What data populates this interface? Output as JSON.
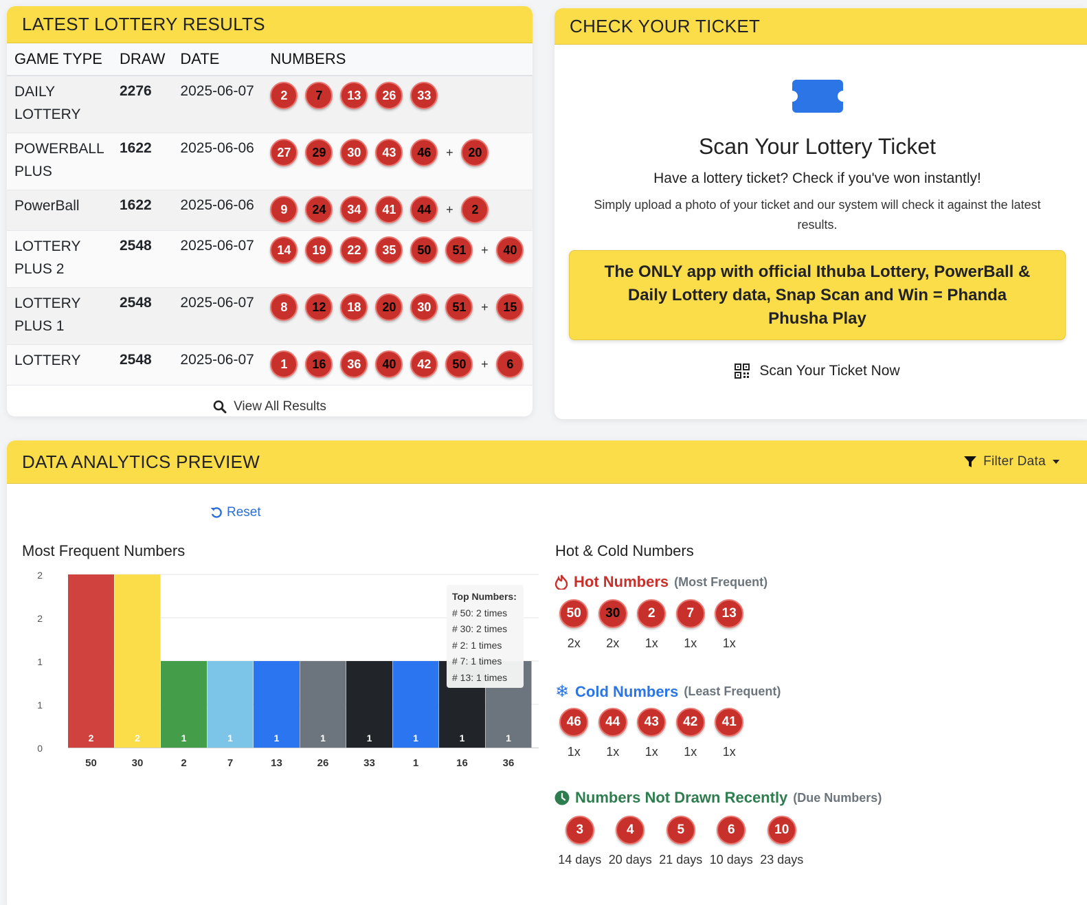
{
  "results": {
    "title": "LATEST LOTTERY RESULTS",
    "headers": [
      "GAME TYPE",
      "DRAW",
      "DATE",
      "NUMBERS"
    ],
    "rows": [
      {
        "game": "DAILY LOTTERY",
        "draw": "2276",
        "date": "2025-06-07",
        "numbers": [
          "2",
          "7",
          "13",
          "26",
          "33"
        ],
        "bonus": ""
      },
      {
        "game": "POWERBALL PLUS",
        "draw": "1622",
        "date": "2025-06-06",
        "numbers": [
          "27",
          "29",
          "30",
          "43",
          "46"
        ],
        "bonus": "20"
      },
      {
        "game": "PowerBall",
        "draw": "1622",
        "date": "2025-06-06",
        "numbers": [
          "9",
          "24",
          "34",
          "41",
          "44"
        ],
        "bonus": "2"
      },
      {
        "game": "LOTTERY PLUS 2",
        "draw": "2548",
        "date": "2025-06-07",
        "numbers": [
          "14",
          "19",
          "22",
          "35",
          "50",
          "51"
        ],
        "bonus": "40"
      },
      {
        "game": "LOTTERY PLUS 1",
        "draw": "2548",
        "date": "2025-06-07",
        "numbers": [
          "8",
          "12",
          "18",
          "20",
          "30",
          "51"
        ],
        "bonus": "15"
      },
      {
        "game": "LOTTERY",
        "draw": "2548",
        "date": "2025-06-07",
        "numbers": [
          "1",
          "16",
          "36",
          "40",
          "42",
          "50"
        ],
        "bonus": "6"
      }
    ],
    "plus_sign": "+",
    "view_all_label": "View All Results"
  },
  "ticket": {
    "title": "CHECK YOUR TICKET",
    "scan_title": "Scan Your Lottery Ticket",
    "scan_sub": "Have a lottery ticket? Check if you've won instantly!",
    "scan_desc": "Simply upload a photo of your ticket and our system will check it against the latest results.",
    "promo": "The ONLY app with official Ithuba Lottery, PowerBall & Daily Lottery data, Snap Scan and Win = Phanda Phusha Play",
    "scan_now_label": "Scan Your Ticket Now",
    "icon_color": "#2b75e6"
  },
  "analytics": {
    "title": "DATA ANALYTICS PREVIEW",
    "filter_label": "Filter Data",
    "reset_label": "Reset",
    "chart_title": "Most Frequent Numbers",
    "hotcold_title": "Hot & Cold Numbers",
    "hot": {
      "label": "Hot Numbers",
      "sub": "(Most Frequent)",
      "color": "#c8312b",
      "items": [
        {
          "n": "50",
          "c": "2x"
        },
        {
          "n": "30",
          "c": "2x"
        },
        {
          "n": "2",
          "c": "1x"
        },
        {
          "n": "7",
          "c": "1x"
        },
        {
          "n": "13",
          "c": "1x"
        }
      ]
    },
    "cold": {
      "label": "Cold Numbers",
      "sub": "(Least Frequent)",
      "color": "#2b75e6",
      "items": [
        {
          "n": "46",
          "c": "1x"
        },
        {
          "n": "44",
          "c": "1x"
        },
        {
          "n": "43",
          "c": "1x"
        },
        {
          "n": "42",
          "c": "1x"
        },
        {
          "n": "41",
          "c": "1x"
        }
      ]
    },
    "due": {
      "label": "Numbers Not Drawn Recently",
      "sub": "(Due Numbers)",
      "color": "#2e7d4f",
      "items": [
        {
          "n": "3",
          "c": "14 days"
        },
        {
          "n": "4",
          "c": "20 days"
        },
        {
          "n": "5",
          "c": "21 days"
        },
        {
          "n": "6",
          "c": "10 days"
        },
        {
          "n": "10",
          "c": "23 days"
        }
      ]
    },
    "tooltip": {
      "title": "Top Numbers:",
      "lines": [
        "# 50: 2 times",
        "# 30: 2 times",
        "# 2: 1 times",
        "# 7: 1 times",
        "# 13: 1 times"
      ]
    }
  },
  "chart_data": {
    "type": "bar",
    "categories": [
      "50",
      "30",
      "2",
      "7",
      "13",
      "26",
      "33",
      "1",
      "16",
      "36"
    ],
    "values": [
      2,
      2,
      1,
      1,
      1,
      1,
      1,
      1,
      1,
      1
    ],
    "colors": [
      "#d0423d",
      "#fbdd4a",
      "#449d48",
      "#7cc4e8",
      "#2b75f0",
      "#6c757d",
      "#212529",
      "#2b75f0",
      "#212529",
      "#6c757d"
    ],
    "y_tick_labels": [
      "0",
      "1",
      "1",
      "2",
      "2"
    ],
    "ylim": [
      0,
      2
    ],
    "grid": true
  }
}
